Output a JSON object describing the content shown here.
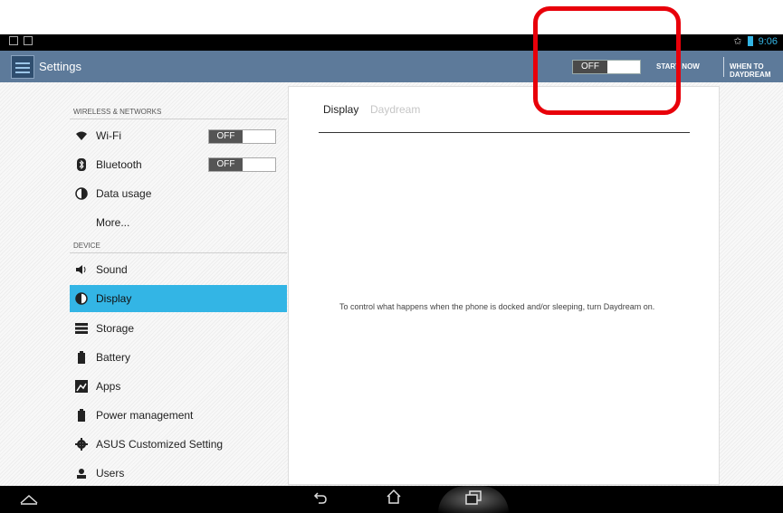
{
  "app": {
    "title": "Settings"
  },
  "status_bar": {
    "time": "9:06"
  },
  "action_bar": {
    "toggle_label": "OFF",
    "start_now_label": "START NOW",
    "when_to_daydream_label": "WHEN TO DAYDREAM"
  },
  "sidebar": {
    "section_wireless": "WIRELESS & NETWORKS",
    "section_device": "DEVICE",
    "items": [
      {
        "label": "Wi-Fi",
        "icon": "wifi-icon",
        "toggle": "OFF"
      },
      {
        "label": "Bluetooth",
        "icon": "bluetooth-icon",
        "toggle": "OFF"
      },
      {
        "label": "Data usage",
        "icon": "data-usage-icon"
      },
      {
        "label": "More...",
        "icon": ""
      },
      {
        "label": "Sound",
        "icon": "sound-icon"
      },
      {
        "label": "Display",
        "icon": "display-icon",
        "selected": true
      },
      {
        "label": "Storage",
        "icon": "storage-icon"
      },
      {
        "label": "Battery",
        "icon": "battery-icon"
      },
      {
        "label": "Apps",
        "icon": "apps-icon"
      },
      {
        "label": "Power management",
        "icon": "power-icon"
      },
      {
        "label": "ASUS Customized Setting",
        "icon": "gear-icon"
      },
      {
        "label": "Users",
        "icon": "users-icon"
      }
    ]
  },
  "detail": {
    "breadcrumb_main": "Display",
    "breadcrumb_sub": "Daydream",
    "message": "To control what happens when the phone is docked and/or sleeping, turn Daydream on."
  },
  "colors": {
    "accent": "#33b5e5",
    "action_bar": "#5d7a9a",
    "highlight": "#e8000a"
  }
}
